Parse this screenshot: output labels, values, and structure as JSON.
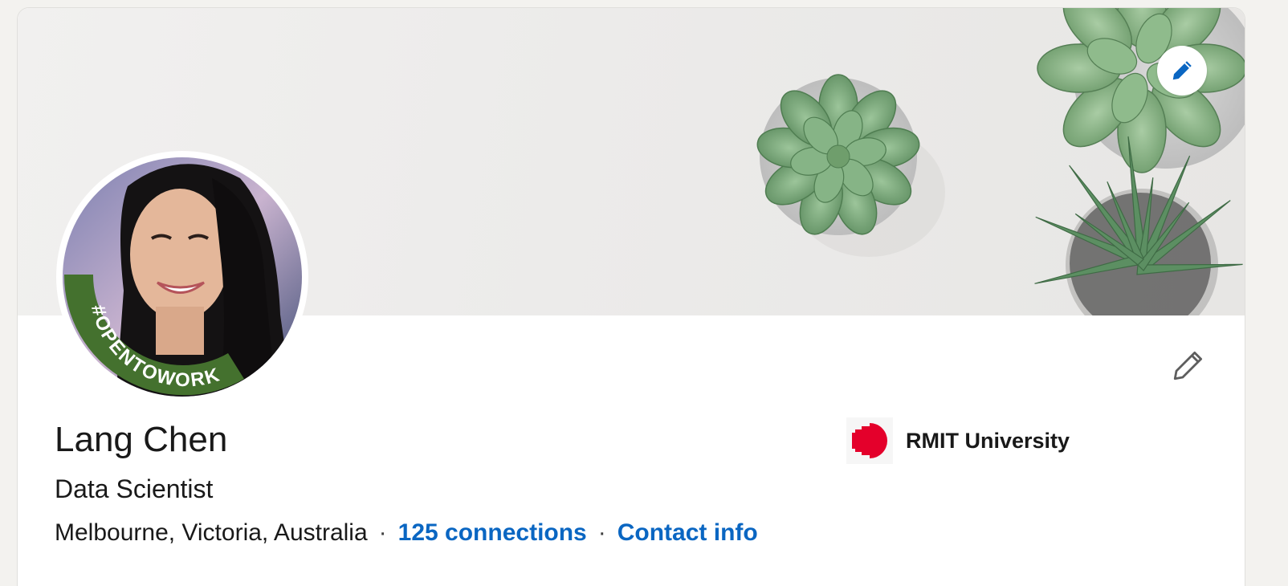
{
  "profile": {
    "name": "Lang Chen",
    "headline": "Data Scientist",
    "location": "Melbourne, Victoria, Australia",
    "connections": "125 connections",
    "contact_info": "Contact info",
    "separator": "·",
    "open_to_work_frame_text": "#OPENTOWORK"
  },
  "education": {
    "school_name": "RMIT University"
  },
  "colors": {
    "link": "#0a66c2",
    "open_to_work_green": "#44712e",
    "school_brand_red": "#e4002b"
  },
  "icons": {
    "cover_edit": "pencil-icon",
    "intro_edit": "pencil-icon"
  }
}
